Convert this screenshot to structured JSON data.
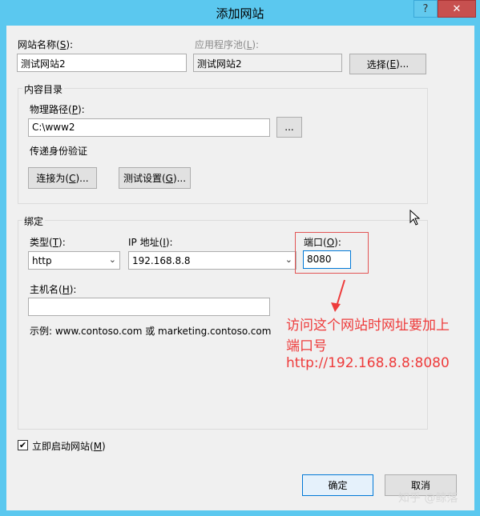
{
  "window": {
    "title": "添加网站",
    "help_glyph": "?",
    "close_glyph": "✕"
  },
  "site_name": {
    "label_prefix": "网站名称(",
    "label_key": "S",
    "label_suffix": "):",
    "value": "测试网站2"
  },
  "app_pool": {
    "label_prefix": "应用程序池(",
    "label_key": "L",
    "label_suffix": "):",
    "value": "测试网站2",
    "select_button_prefix": "选择(",
    "select_button_key": "E",
    "select_button_suffix": ")..."
  },
  "content_dir": {
    "group_title": "内容目录",
    "physical_path": {
      "label_prefix": "物理路径(",
      "label_key": "P",
      "label_suffix": "):",
      "value": "C:\\www2",
      "browse_label": "..."
    },
    "pass_through_auth": "传递身份验证",
    "connect_as_prefix": "连接为(",
    "connect_as_key": "C",
    "connect_as_suffix": ")...",
    "test_settings_prefix": "测试设置(",
    "test_settings_key": "G",
    "test_settings_suffix": ")..."
  },
  "binding": {
    "group_title": "绑定",
    "type": {
      "label_prefix": "类型(",
      "label_key": "T",
      "label_suffix": "):",
      "value": "http"
    },
    "ip": {
      "label_prefix": "IP 地址(",
      "label_key": "I",
      "label_suffix": "):",
      "value": "192.168.8.8"
    },
    "port": {
      "label_prefix": "端口(",
      "label_key": "O",
      "label_suffix": "):",
      "value": "8080"
    },
    "hostname": {
      "label_prefix": "主机名(",
      "label_key": "H",
      "label_suffix": "):",
      "value": ""
    },
    "example": "示例: www.contoso.com 或 marketing.contoso.com"
  },
  "start_immediately": {
    "label_prefix": "立即启动网站(",
    "label_key": "M",
    "label_suffix": ")",
    "checked": true,
    "check_glyph": "✔"
  },
  "buttons": {
    "ok": "确定",
    "cancel": "取消"
  },
  "annotation": {
    "line1": "访问这个网站时网址要加上",
    "line2": "端口号",
    "line3": "http://192.168.8.8:8080",
    "color": "#ee3b3b"
  },
  "watermark": "知乎 @鲸落"
}
